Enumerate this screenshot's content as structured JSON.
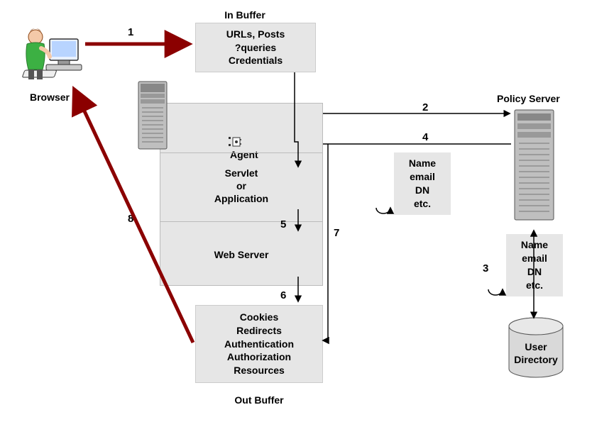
{
  "labels": {
    "browser": "Browser",
    "in_buffer": "In Buffer",
    "out_buffer": "Out Buffer",
    "policy_server": "Policy Server",
    "agent": "Agent",
    "user_directory": "User\nDirectory"
  },
  "boxes": {
    "in_buffer_box": "URLs, Posts\n?queries\nCredentials",
    "servlet_box": "Servlet\nor\nApplication",
    "web_server_box": "Web Server",
    "out_buffer_box": "Cookies\nRedirects\nAuthentication\nAuthorization\nResources",
    "attrs_4": "Name\nemail\nDN\netc.",
    "attrs_3": "Name\nemail\nDN\netc."
  },
  "numbers": {
    "n1": "1",
    "n2": "2",
    "n3": "3",
    "n4": "4",
    "n5": "5",
    "n6": "6",
    "n7": "7",
    "n8": "8"
  },
  "colors": {
    "arrow_red": "#8b0000",
    "arrow_black": "#000000",
    "box_fill": "#e6e6e6",
    "server_body": "#bfbfbf",
    "server_dark": "#808080",
    "db_fill": "#d9d9d9"
  }
}
